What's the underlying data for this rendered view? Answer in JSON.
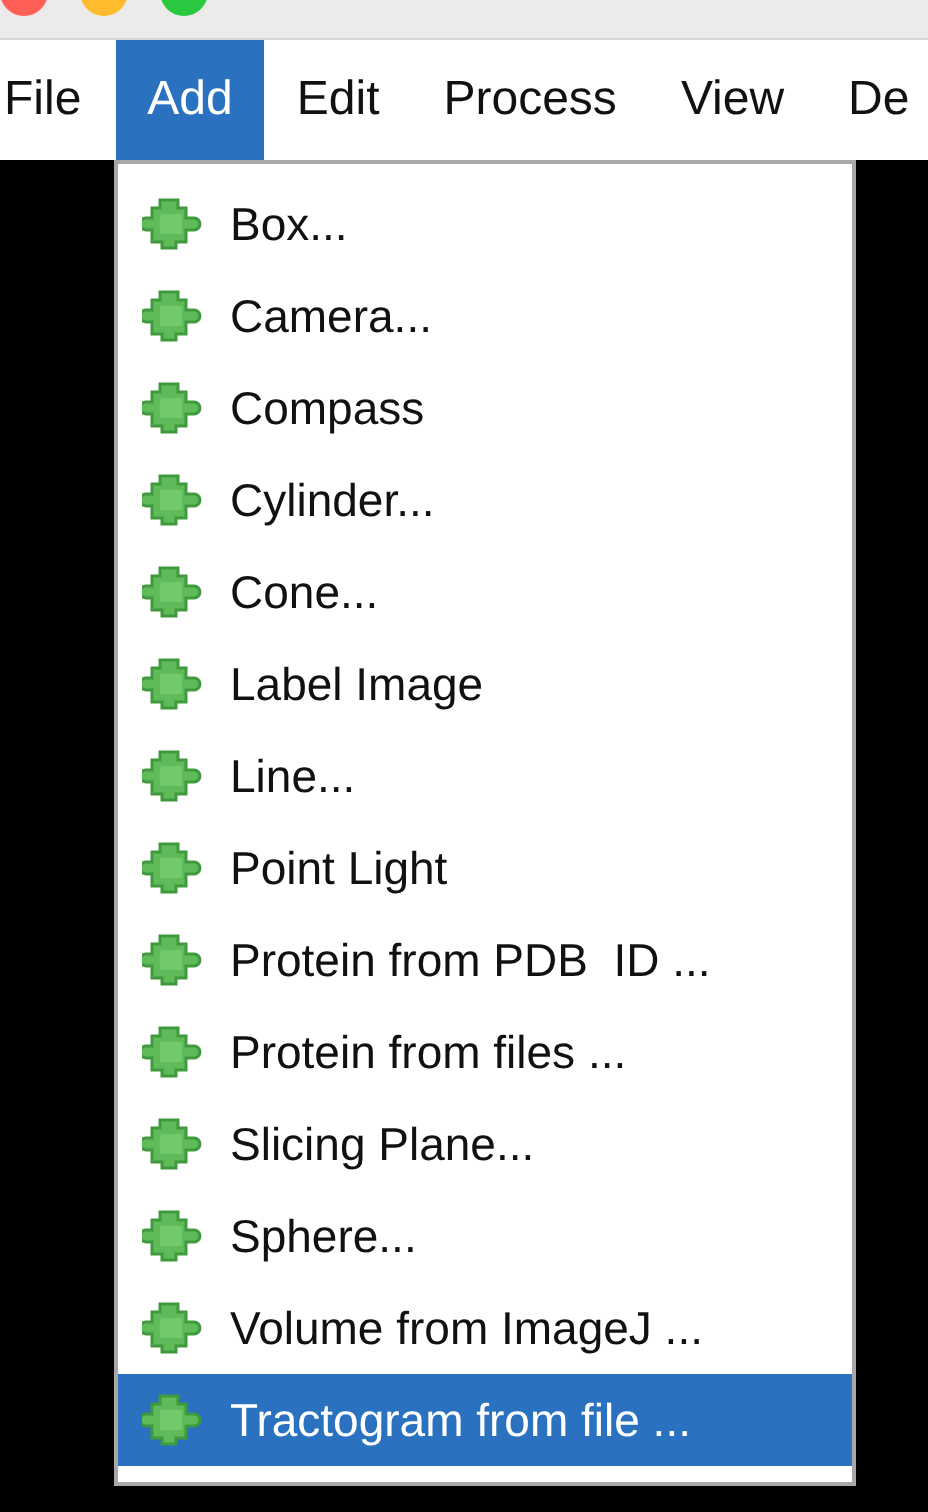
{
  "menu_bar": [
    {
      "label": "File",
      "selected": false
    },
    {
      "label": "Add",
      "selected": true
    },
    {
      "label": "Edit",
      "selected": false
    },
    {
      "label": "Process",
      "selected": false
    },
    {
      "label": "View",
      "selected": false
    },
    {
      "label": "De",
      "selected": false
    }
  ],
  "menu": {
    "items": [
      {
        "label": "Box...",
        "selected": false
      },
      {
        "label": "Camera...",
        "selected": false
      },
      {
        "label": "Compass",
        "selected": false
      },
      {
        "label": "Cylinder...",
        "selected": false
      },
      {
        "label": "Cone...",
        "selected": false
      },
      {
        "label": "Label Image",
        "selected": false
      },
      {
        "label": "Line...",
        "selected": false
      },
      {
        "label": "Point Light",
        "selected": false
      },
      {
        "label": "Protein from PDB  ID ...",
        "selected": false
      },
      {
        "label": "Protein from files ...",
        "selected": false
      },
      {
        "label": "Slicing Plane...",
        "selected": false
      },
      {
        "label": "Sphere...",
        "selected": false
      },
      {
        "label": "Volume from ImageJ ...",
        "selected": false
      },
      {
        "label": "Tractogram from file ...",
        "selected": true
      }
    ]
  }
}
